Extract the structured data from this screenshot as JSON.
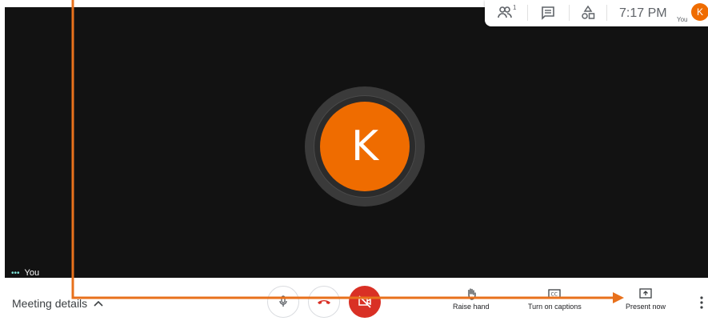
{
  "stage": {
    "avatar_initial": "K",
    "self_label": "You",
    "self_label_dots": "•••"
  },
  "topbar": {
    "people_count": "1",
    "time": "7:17 PM",
    "you_label": "You",
    "avatar_initial": "K"
  },
  "bottombar": {
    "meeting_details_label": "Meeting details",
    "raise_hand_label": "Raise hand",
    "captions_label": "Turn on captions",
    "present_label": "Present now"
  },
  "colors": {
    "stage_bg": "#121212",
    "avatar": "#ef6c00",
    "hangup_red": "#d93025",
    "annotation": "#e8711c"
  },
  "icons": {
    "people": "people-icon",
    "chat": "chat-icon",
    "activities": "shapes-icon",
    "mic": "mic-icon",
    "hangup": "hangup-icon",
    "camera_off": "camera-off-icon",
    "raise_hand": "hand-icon",
    "captions": "cc-icon",
    "present": "present-icon",
    "more": "more-vert-icon",
    "chevron": "chevron-up-icon"
  }
}
